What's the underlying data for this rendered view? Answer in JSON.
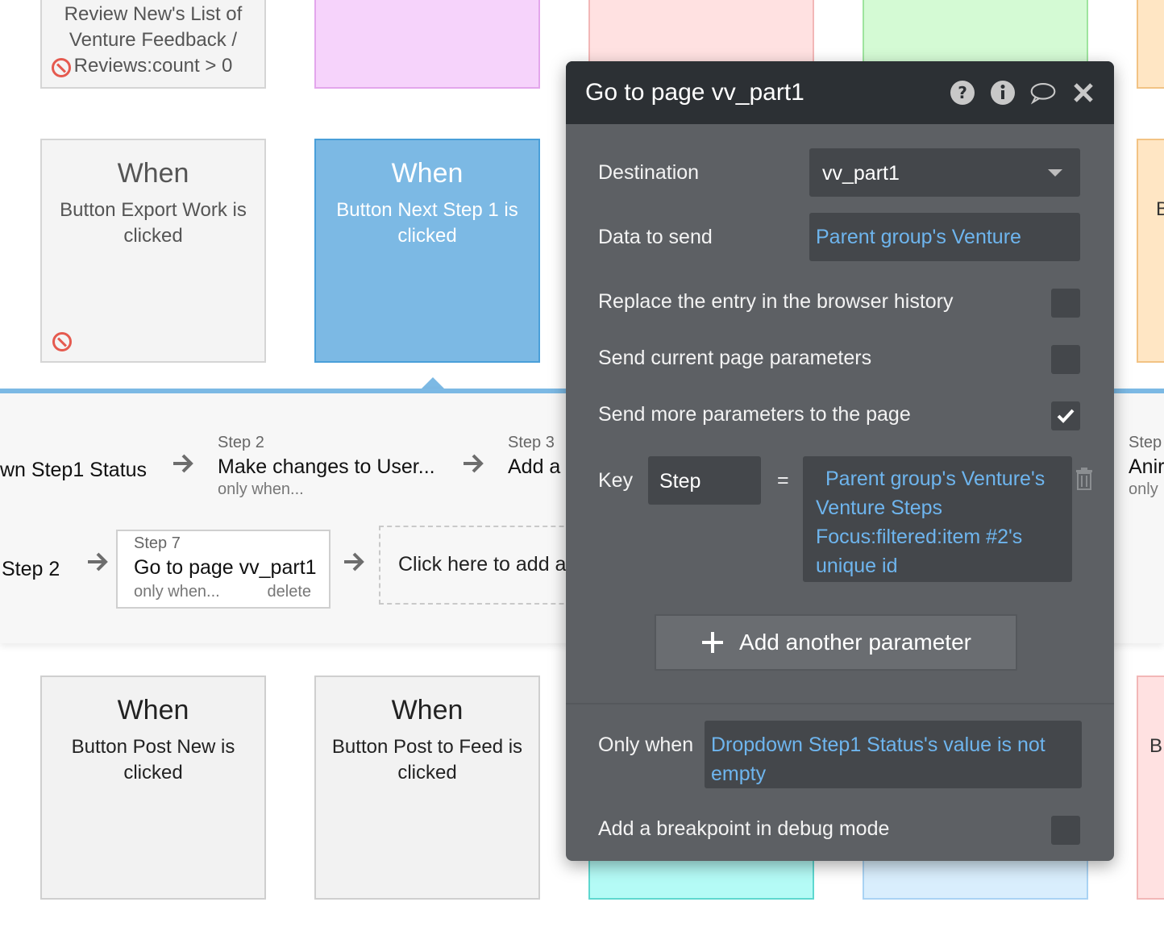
{
  "cards_top": {
    "card1_desc": "Review New's List of Venture Feedback / Reviews:count > 0"
  },
  "cards_mid": [
    {
      "title": "When",
      "desc": "Button Export Work is clicked"
    },
    {
      "title": "When",
      "desc": "Button Next Step 1 is clicked"
    },
    {
      "title": "B"
    }
  ],
  "cards_bottom": [
    {
      "title": "When",
      "desc": "Button Post New is clicked"
    },
    {
      "title": "When",
      "desc": "Button Post to Feed is clicked"
    },
    {
      "title": "B"
    }
  ],
  "workflow": {
    "row1": [
      {
        "name": "wn Step1 Status"
      },
      {
        "label": "Step 2",
        "name": "Make changes to User...",
        "cond": "only when..."
      },
      {
        "label": "Step 3",
        "name": "Add a"
      },
      {
        "label": "Step",
        "name": "Anir",
        "cond": "only"
      }
    ],
    "row2": [
      {
        "name": "Step 2"
      },
      {
        "label": "Step 7",
        "name": "Go to page vv_part1",
        "cond": "only when...",
        "delete": "delete"
      }
    ],
    "add_action": "Click here to add an action..."
  },
  "panel": {
    "title": "Go to page vv_part1",
    "icons": [
      "help-icon",
      "info-icon",
      "comment-icon",
      "close-icon"
    ],
    "destination_label": "Destination",
    "destination_value": "vv_part1",
    "data_label": "Data to send",
    "data_value": "Parent group's Venture",
    "replace_label": "Replace the entry in the browser history",
    "replace_checked": false,
    "send_current_label": "Send current page parameters",
    "send_current_checked": false,
    "send_more_label": "Send more parameters to the page",
    "send_more_checked": true,
    "key_label": "Key",
    "key_value": "Step",
    "equals": "=",
    "param_value": "Parent group's Venture's Venture Steps Focus:filtered:item #2's unique id",
    "add_param_label": "Add another parameter",
    "only_when_label": "Only when",
    "only_when_value": "Dropdown Step1 Status's value is not empty",
    "breakpoint_label": "Add a breakpoint in debug mode",
    "breakpoint_checked": false
  },
  "colors": {
    "pink": "#f6d3fb",
    "salmon": "#ffe1e1",
    "green": "#d4fad4",
    "orange": "#ffe6c4",
    "cyan": "#b4fbf6",
    "lightblue": "#d9eefd",
    "accent": "#7cb9e4",
    "link": "#6eb5ee"
  }
}
